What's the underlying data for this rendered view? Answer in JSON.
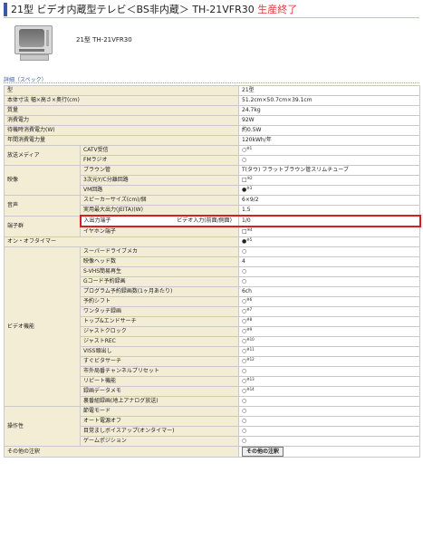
{
  "title": {
    "main": "21型 ビデオ内蔵型テレビ＜BS非内蔵＞ TH-21VFR30",
    "status": "生産終了"
  },
  "model_label": "21型 TH-21VFR30",
  "section_label": "詳細（スペック）",
  "rows": [
    {
      "cat": "型",
      "value": "21型"
    },
    {
      "cat": "本体寸法 幅×高さ×奥行(cm)",
      "value": "51.2cm×50.7cm×39.1cm"
    },
    {
      "cat": "質量",
      "value": "24.7kg"
    },
    {
      "cat": "消費電力",
      "value": "92W"
    },
    {
      "cat": "待機時消費電力(W)",
      "value": "約0.5W"
    },
    {
      "cat": "年間消費電力量",
      "value": "120kWh/年"
    },
    {
      "cat": "放送メディア",
      "sub": "CATV受信",
      "value": "○",
      "note": "※1"
    },
    {
      "sub": "FMラジオ",
      "value": "○"
    },
    {
      "cat": "映像",
      "sub": "ブラウン管",
      "value": "T(タウ) フラットブラウン管スリムチューブ"
    },
    {
      "sub": "3次元Y/C分離回路",
      "value": "□",
      "note": "※2"
    },
    {
      "sub": "VM回路",
      "value": "●",
      "note": "※3"
    },
    {
      "cat": "音声",
      "sub": "スピーカーサイズ(cm)/個",
      "value": "6×9/2"
    },
    {
      "sub": "実用最大出力(JEITA)(W)",
      "value": "1.5"
    },
    {
      "cat": "端子群",
      "sub": "入出力端子",
      "sub2": "ビデオ入力(前面/側面)",
      "value": "1/0",
      "hl": true
    },
    {
      "sub": "イヤホン端子",
      "value": "□",
      "note": "※4"
    },
    {
      "cat": "オン・オフタイマー",
      "value": "●",
      "note": "※5"
    },
    {
      "cat": "ビデオ機能",
      "sub": "スーパードライブメカ",
      "value": "○"
    },
    {
      "sub": "映像ヘッド数",
      "value": "4"
    },
    {
      "sub": "S-VHS簡易再生",
      "value": "○"
    },
    {
      "sub": "Gコード予約録画",
      "value": "○"
    },
    {
      "sub": "プログラム予約録画数(1ヶ月あたり)",
      "value": "6ch"
    },
    {
      "sub": "予約シフト",
      "value": "○",
      "note": "※6"
    },
    {
      "sub": "ワンタッチ録画",
      "value": "○",
      "note": "※7"
    },
    {
      "sub": "トップ&エンドサーチ",
      "value": "○",
      "note": "※8"
    },
    {
      "sub": "ジャストクロック",
      "value": "○",
      "note": "※9"
    },
    {
      "sub": "ジャストREC",
      "value": "○",
      "note": "※10"
    },
    {
      "sub": "VISS頭出し",
      "value": "○",
      "note": "※11"
    },
    {
      "sub": "すぐビタサーチ",
      "value": "○",
      "note": "※12"
    },
    {
      "sub": "市外局番チャンネルプリセット",
      "value": "○"
    },
    {
      "sub": "リピート機能",
      "value": "○",
      "note": "※13"
    },
    {
      "sub": "録画データメモ",
      "value": "○",
      "note": "※14"
    },
    {
      "sub": "裏番組録画(地上アナログ放送)",
      "value": "○"
    },
    {
      "cat": "操作性",
      "sub": "節電モード",
      "value": "○"
    },
    {
      "sub": "オート電源オフ",
      "value": "○"
    },
    {
      "sub": "目覚ましボイスアップ(オンタイマー)",
      "value": "○"
    },
    {
      "sub": "ゲームポジション",
      "value": "○"
    },
    {
      "cat": "その他の注釈",
      "button": "その他の注釈"
    }
  ],
  "colors": {
    "accent": "#3a5aa8",
    "status": "#e23b3b",
    "label_bg": "#f4edd6",
    "highlight_border": "#d81f1f"
  },
  "icons": {
    "product": "tv-image"
  }
}
